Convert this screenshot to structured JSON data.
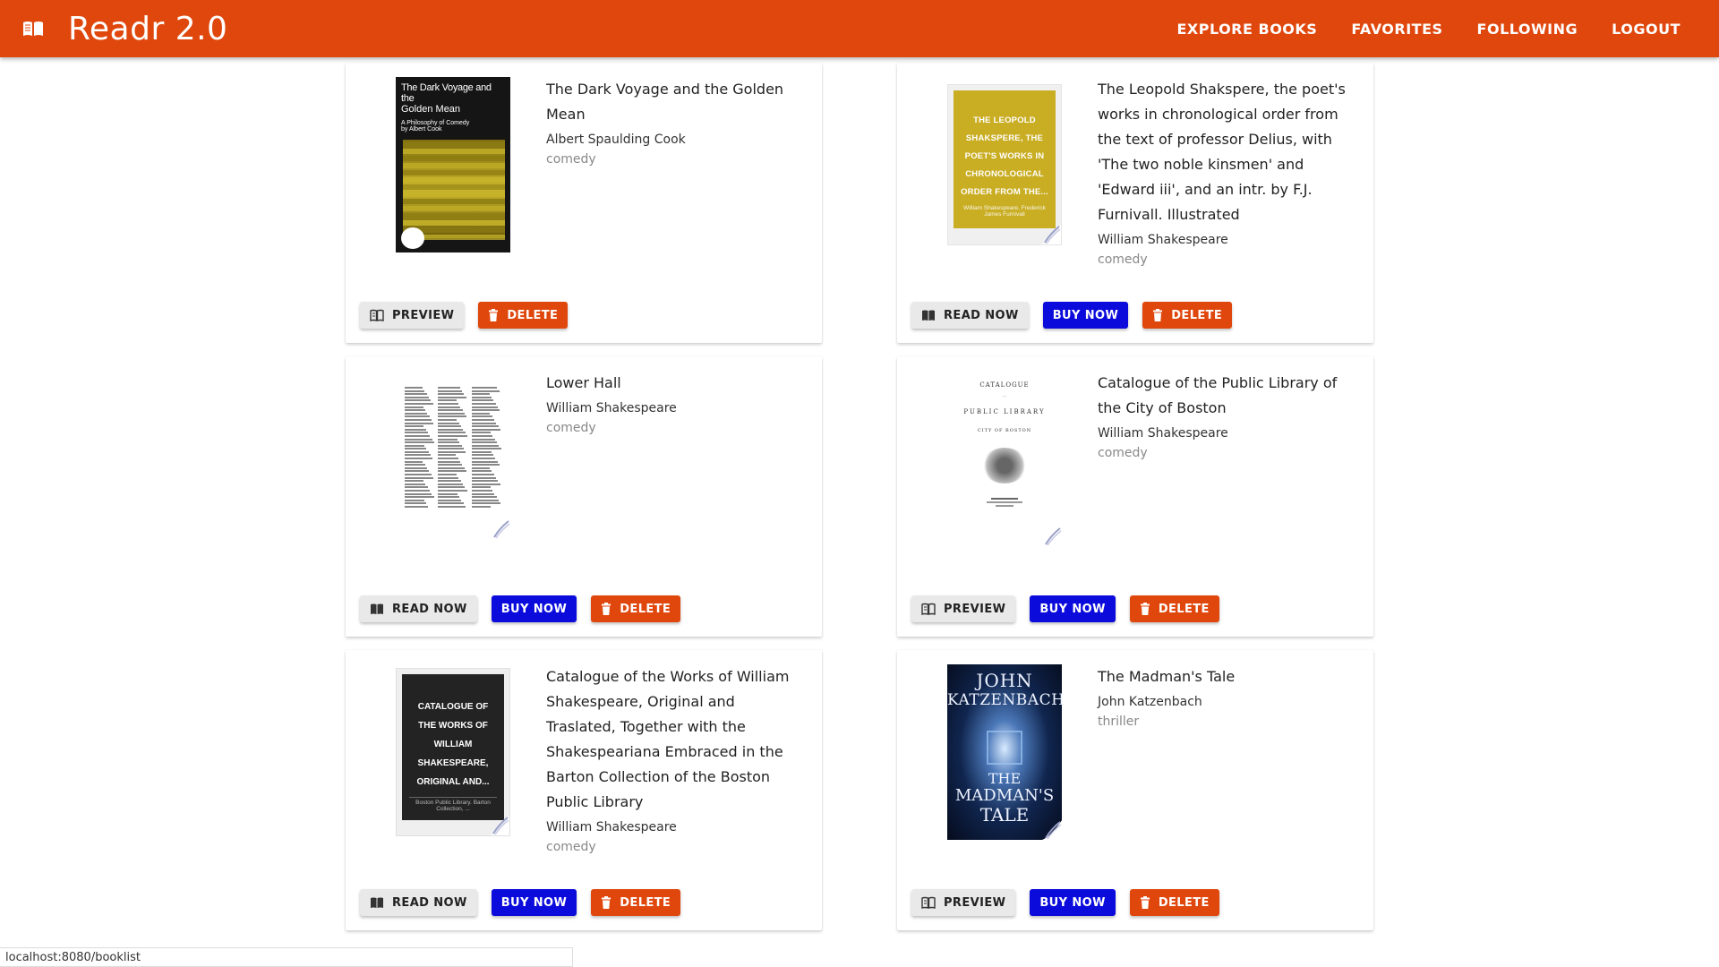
{
  "app": {
    "title": "Readr 2.0",
    "brand_icon": "open-book-icon"
  },
  "nav": {
    "items": [
      "EXPLORE BOOKS",
      "FAVORITES",
      "FOLLOWING",
      "LOGOUT"
    ]
  },
  "colors": {
    "primary": "#e0470d",
    "buy": "#0b0bdc",
    "neutral": "#e9e9e9"
  },
  "books": [
    {
      "title": "The Dark Voyage and the Golden Mean",
      "author": "Albert Spaulding Cook",
      "genre": "comedy",
      "cover": {
        "style": "photo-yellow",
        "line1": "The Dark Voyage and the",
        "line2": "Golden Mean",
        "line3": "A Philosophy of Comedy",
        "line4": "by Albert Cook"
      },
      "buttons": [
        {
          "label": "PREVIEW",
          "kind": "grey",
          "icon": "book-preview-icon"
        },
        {
          "label": "DELETE",
          "kind": "red",
          "icon": "trash-icon"
        }
      ]
    },
    {
      "title": "The Leopold Shakspere, the poet's works in chronological order from the text of professor Delius, with 'The two noble kinsmen' and 'Edward iii', and an intr. by F.J. Furnivall. Illustrated",
      "author": "William Shakespeare",
      "genre": "comedy",
      "cover": {
        "style": "placeholder-gold",
        "line1": "THE LEOPOLD SHAKSPERE, THE POET'S WORKS IN CHRONOLOGICAL ORDER FROM THE...",
        "line2": "William Shakespeare, Frederick James Furnivall"
      },
      "buttons": [
        {
          "label": "READ NOW",
          "kind": "grey",
          "icon": "book-read-icon"
        },
        {
          "label": "BUY NOW",
          "kind": "blue",
          "icon": ""
        },
        {
          "label": "DELETE",
          "kind": "red",
          "icon": "trash-icon"
        }
      ]
    },
    {
      "title": "Lower Hall",
      "author": "William Shakespeare",
      "genre": "comedy",
      "cover": {
        "style": "scan-text"
      },
      "buttons": [
        {
          "label": "READ NOW",
          "kind": "grey",
          "icon": "book-read-icon"
        },
        {
          "label": "BUY NOW",
          "kind": "blue",
          "icon": ""
        },
        {
          "label": "DELETE",
          "kind": "red",
          "icon": "trash-icon"
        }
      ]
    },
    {
      "title": "Catalogue of the Public Library of the City of Boston",
      "author": "William Shakespeare",
      "genre": "comedy",
      "cover": {
        "style": "scan-title",
        "line1": "CATALOGUE",
        "line2": "PUBLIC LIBRARY",
        "line3": "CITY OF BOSTON"
      },
      "buttons": [
        {
          "label": "PREVIEW",
          "kind": "grey",
          "icon": "book-preview-icon"
        },
        {
          "label": "BUY NOW",
          "kind": "blue",
          "icon": ""
        },
        {
          "label": "DELETE",
          "kind": "red",
          "icon": "trash-icon"
        }
      ]
    },
    {
      "title": "Catalogue of the Works of William Shakespeare, Original and Traslated, Together with the Shakespeariana Embraced in the Barton Collection of the Boston Public Library",
      "author": "William Shakespeare",
      "genre": "comedy",
      "cover": {
        "style": "placeholder-dark",
        "line1": "CATALOGUE OF THE WORKS OF WILLIAM SHAKESPEARE, ORIGINAL AND...",
        "line2": "Boston Public Library. Barton Collection, ..."
      },
      "buttons": [
        {
          "label": "READ NOW",
          "kind": "grey",
          "icon": "book-read-icon"
        },
        {
          "label": "BUY NOW",
          "kind": "blue",
          "icon": ""
        },
        {
          "label": "DELETE",
          "kind": "red",
          "icon": "trash-icon"
        }
      ]
    },
    {
      "title": "The Madman's Tale",
      "author": "John Katzenbach",
      "genre": "thriller",
      "cover": {
        "style": "photo-blue",
        "line1": "JOHN",
        "line2": "KATZENBACH",
        "line3": "THE",
        "line4": "MADMAN'S",
        "line5": "TALE"
      },
      "buttons": [
        {
          "label": "PREVIEW",
          "kind": "grey",
          "icon": "book-preview-icon"
        },
        {
          "label": "BUY NOW",
          "kind": "blue",
          "icon": ""
        },
        {
          "label": "DELETE",
          "kind": "red",
          "icon": "trash-icon"
        }
      ]
    }
  ],
  "statusbar": {
    "url": "localhost:8080/booklist"
  }
}
